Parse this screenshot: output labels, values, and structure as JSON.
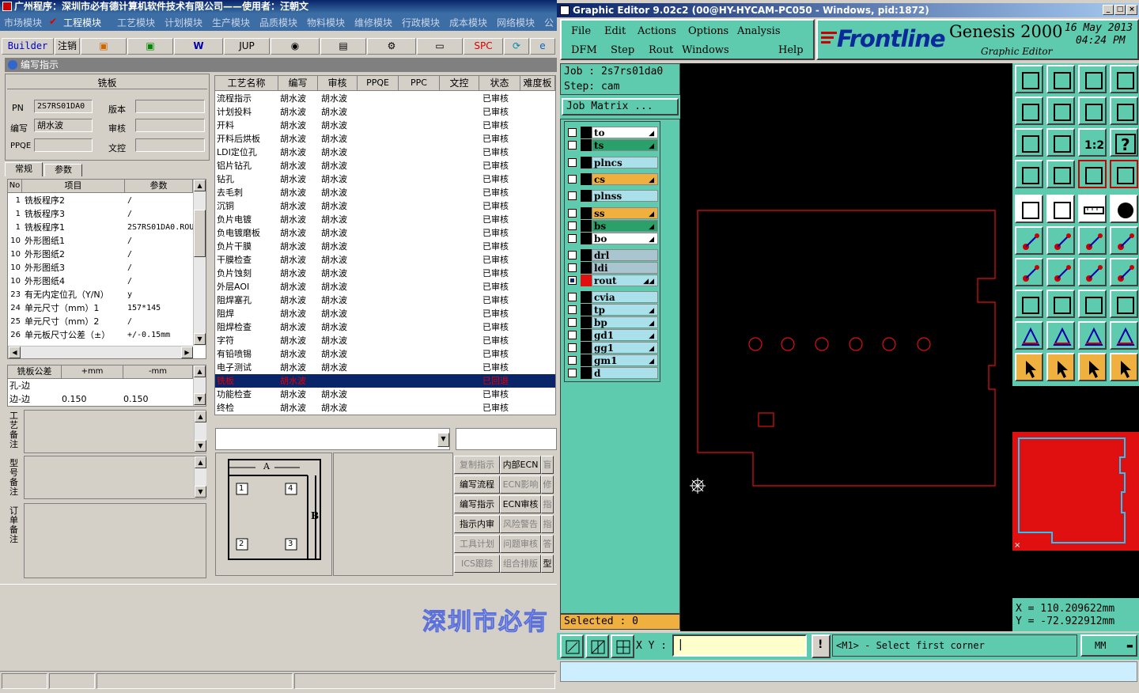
{
  "left_app": {
    "title": "广州程序：深圳市必有德计算机软件技术有限公司——使用者：汪朝文",
    "menu": [
      "市场模块",
      "工程模块",
      "工艺模块",
      "计划模块",
      "生产模块",
      "品质模块",
      "物料模块",
      "维修模块",
      "行政模块",
      "成本模块",
      "网络模块",
      "公"
    ],
    "toolbar": {
      "builder": "Builder",
      "logout": "注销",
      "jup": "JUP",
      "spc": "SPC"
    },
    "subtitle": "编写指示",
    "board": {
      "header": "铣板",
      "pn_label": "PN",
      "pn_value": "2S7RS01DA0",
      "version_label": "版本",
      "author_label": "编写",
      "author_value": "胡水波",
      "review_label": "审核",
      "ppqe_label": "PPQE",
      "review2_label": "文控"
    },
    "tabs": [
      "常规",
      "参数"
    ],
    "param_table": {
      "headers": [
        "No",
        "项目",
        "参数"
      ],
      "rows": [
        [
          "1",
          "铣板程序2",
          "/"
        ],
        [
          "1",
          "铣板程序3",
          "/"
        ],
        [
          "1",
          "铣板程序1",
          "2S7RS01DA0.ROU"
        ],
        [
          "10",
          "外形图纸1",
          "/"
        ],
        [
          "10",
          "外形图纸2",
          "/"
        ],
        [
          "10",
          "外形图纸3",
          "/"
        ],
        [
          "10",
          "外形图纸4",
          "/"
        ],
        [
          "23",
          "有无内定位孔（Y/N）",
          "y"
        ],
        [
          "24",
          "单元尺寸（mm）1",
          "157*145"
        ],
        [
          "25",
          "单元尺寸（mm）2",
          "/"
        ],
        [
          "26",
          "单元板尺寸公差（±）",
          "+/-0.15mm"
        ]
      ]
    },
    "tolerance": {
      "headers": [
        "铣板公差",
        "+mm",
        "-mm"
      ],
      "rows": [
        [
          "孔-边",
          "",
          ""
        ],
        [
          "边-边",
          "0.150",
          "0.150"
        ]
      ]
    },
    "notes": [
      "工艺备注",
      "型号备注",
      "订单备注"
    ],
    "process_table": {
      "headers": [
        "工艺名称",
        "编写",
        "审核",
        "PPQE",
        "PPC",
        "文控",
        "状态",
        "难度板"
      ],
      "rows": [
        [
          "流程指示",
          "胡水波",
          "胡水波",
          "",
          "",
          "",
          "已审核",
          ""
        ],
        [
          "计划投料",
          "胡水波",
          "胡水波",
          "",
          "",
          "",
          "已审核",
          ""
        ],
        [
          "开料",
          "胡水波",
          "胡水波",
          "",
          "",
          "",
          "已审核",
          ""
        ],
        [
          "开料后烘板",
          "胡水波",
          "胡水波",
          "",
          "",
          "",
          "已审核",
          ""
        ],
        [
          "LDI定位孔",
          "胡水波",
          "胡水波",
          "",
          "",
          "",
          "已审核",
          ""
        ],
        [
          "铝片钻孔",
          "胡水波",
          "胡水波",
          "",
          "",
          "",
          "已审核",
          ""
        ],
        [
          "钻孔",
          "胡水波",
          "胡水波",
          "",
          "",
          "",
          "已审核",
          ""
        ],
        [
          "去毛刺",
          "胡水波",
          "胡水波",
          "",
          "",
          "",
          "已审核",
          ""
        ],
        [
          "沉铜",
          "胡水波",
          "胡水波",
          "",
          "",
          "",
          "已审核",
          ""
        ],
        [
          "负片电镀",
          "胡水波",
          "胡水波",
          "",
          "",
          "",
          "已审核",
          ""
        ],
        [
          "负电镀磨板",
          "胡水波",
          "胡水波",
          "",
          "",
          "",
          "已审核",
          ""
        ],
        [
          "负片干膜",
          "胡水波",
          "胡水波",
          "",
          "",
          "",
          "已审核",
          ""
        ],
        [
          "干膜检查",
          "胡水波",
          "胡水波",
          "",
          "",
          "",
          "已审核",
          ""
        ],
        [
          "负片蚀刻",
          "胡水波",
          "胡水波",
          "",
          "",
          "",
          "已审核",
          ""
        ],
        [
          "外层AOI",
          "胡水波",
          "胡水波",
          "",
          "",
          "",
          "已审核",
          ""
        ],
        [
          "阻焊塞孔",
          "胡水波",
          "胡水波",
          "",
          "",
          "",
          "已审核",
          ""
        ],
        [
          "阻焊",
          "胡水波",
          "胡水波",
          "",
          "",
          "",
          "已审核",
          ""
        ],
        [
          "阻焊检查",
          "胡水波",
          "胡水波",
          "",
          "",
          "",
          "已审核",
          ""
        ],
        [
          "字符",
          "胡水波",
          "胡水波",
          "",
          "",
          "",
          "已审核",
          ""
        ],
        [
          "有铅喷锡",
          "胡水波",
          "胡水波",
          "",
          "",
          "",
          "已审核",
          ""
        ],
        [
          "电子测试",
          "胡水波",
          "胡水波",
          "",
          "",
          "",
          "已审核",
          ""
        ],
        [
          "铣板",
          "胡水波",
          "",
          "",
          "",
          "",
          "已回退",
          ""
        ],
        [
          "功能检查",
          "胡水波",
          "胡水波",
          "",
          "",
          "",
          "已审核",
          ""
        ],
        [
          "终检",
          "胡水波",
          "胡水波",
          "",
          "",
          "",
          "已审核",
          ""
        ]
      ],
      "selected_index": 21
    },
    "diagram": {
      "a": "A",
      "b": "B",
      "n1": "1",
      "n2": "2",
      "n3": "3",
      "n4": "4"
    },
    "buttons": [
      [
        "复制指示",
        "内部ECN",
        "盲"
      ],
      [
        "编写流程",
        "ECN影响",
        "修"
      ],
      [
        "编写指示",
        "ECN审核",
        "指"
      ],
      [
        "指示内审",
        "风险警告",
        "指"
      ],
      [
        "工具计划",
        "问题审核",
        "答"
      ],
      [
        "ICS跟踪",
        "组合排版",
        "型"
      ]
    ],
    "disabled_buttons": [
      "复制指示",
      "ECN影响",
      "风险警告",
      "工具计划",
      "问题审核",
      "ICS跟踪",
      "组合排版",
      "盲",
      "修",
      "指",
      "答"
    ],
    "watermark": "深圳市必有"
  },
  "right_app": {
    "title": "Graphic Editor 9.02c2 (00@HY-HYCAM-PC050 - Windows, pid:1872)",
    "menu_row1": [
      "File",
      "Edit",
      "Actions",
      "Options",
      "Analysis"
    ],
    "menu_row2": [
      "DFM",
      "Step",
      "Rout",
      "Windows",
      "Help"
    ],
    "brand": {
      "logo": "Frontline",
      "product": "Genesis 2000",
      "subtitle": "Graphic Editor",
      "date": "16 May 2013",
      "time": "04:24 PM"
    },
    "job_label": "Job  : 2s7rs01da0",
    "step_label": "Step: cam",
    "job_matrix": "Job Matrix ...",
    "layers": [
      {
        "name": "to",
        "color": "#ffffff",
        "arrow": "◢"
      },
      {
        "name": "ts",
        "color": "#2aa06a",
        "arrow": "◢"
      },
      {
        "name": "plncs",
        "color": "#a9e0ea",
        "arrow": ""
      },
      {
        "name": "cs",
        "color": "#f0b040",
        "arrow": "◢"
      },
      {
        "name": "plnss",
        "color": "#a9e0ea",
        "arrow": ""
      },
      {
        "name": "ss",
        "color": "#f0b040",
        "arrow": "◢"
      },
      {
        "name": "bs",
        "color": "#2aa06a",
        "arrow": "◢"
      },
      {
        "name": "bo",
        "color": "#ffffff",
        "arrow": "◢"
      },
      {
        "name": "drl",
        "color": "#a9c6d0",
        "arrow": ""
      },
      {
        "name": "ldi",
        "color": "#a9c6d0",
        "arrow": ""
      },
      {
        "name": "rout",
        "color": "#a9e0ea",
        "arrow": "◢◢"
      },
      {
        "name": "cvia",
        "color": "#a9e0ea",
        "arrow": ""
      },
      {
        "name": "tp",
        "color": "#a9e0ea",
        "arrow": "◢"
      },
      {
        "name": "bp",
        "color": "#a9e0ea",
        "arrow": "◢"
      },
      {
        "name": "gd1",
        "color": "#a9e0ea",
        "arrow": "◢"
      },
      {
        "name": "gg1",
        "color": "#a9e0ea",
        "arrow": "◢"
      },
      {
        "name": "gm1",
        "color": "#a9e0ea",
        "arrow": "◢"
      },
      {
        "name": "d",
        "color": "#a9e0ea",
        "arrow": ""
      }
    ],
    "selected": "Selected : 0",
    "coords": {
      "x": "X  =  110.209622mm",
      "y": "Y  = -72.922912mm"
    },
    "xy_label": "X Y :",
    "prompt": "<M1> - Select first corner",
    "units": "MM"
  }
}
